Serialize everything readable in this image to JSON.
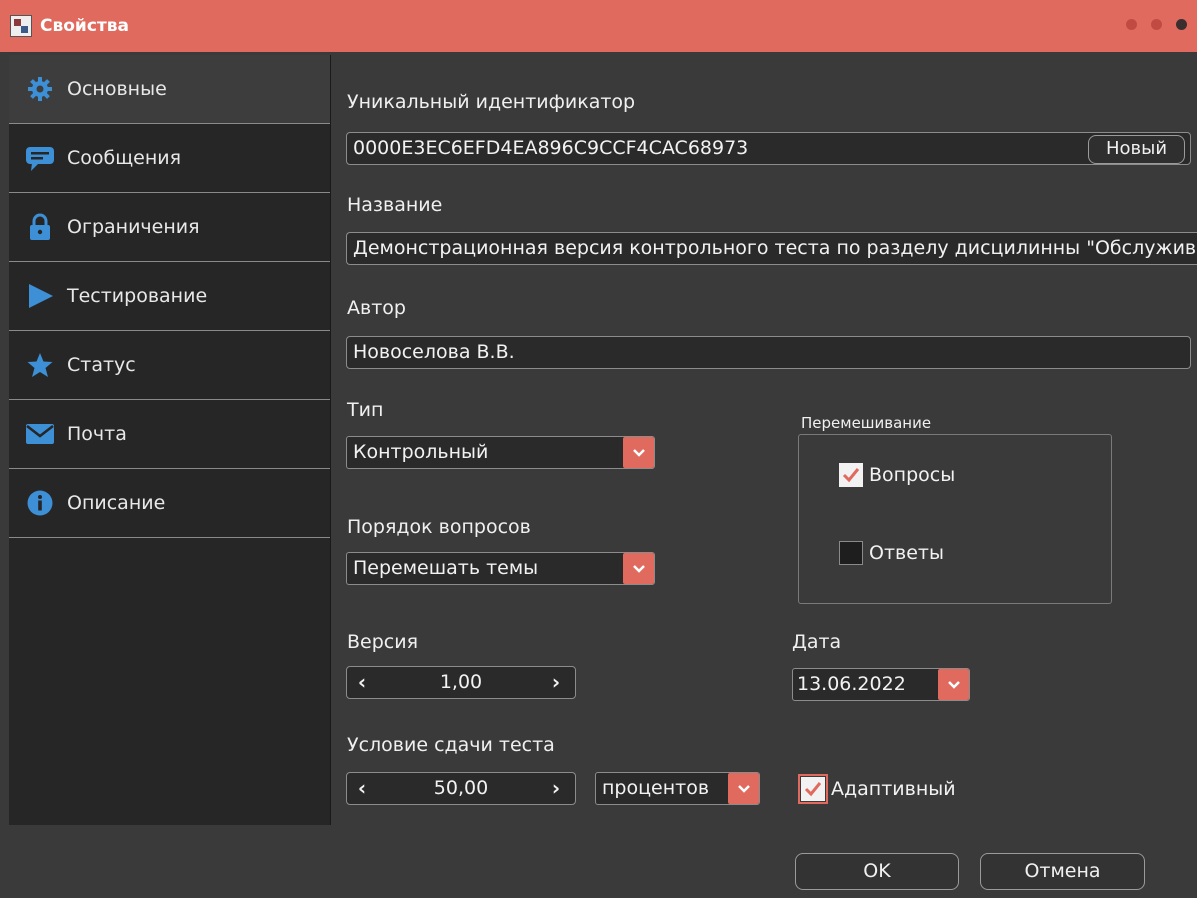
{
  "window": {
    "title": "Свойства"
  },
  "sidebar": {
    "items": [
      {
        "label": "Основные",
        "icon": "gear-icon"
      },
      {
        "label": "Сообщения",
        "icon": "message-icon"
      },
      {
        "label": "Ограничения",
        "icon": "lock-icon"
      },
      {
        "label": "Тестирование",
        "icon": "play-icon"
      },
      {
        "label": "Статус",
        "icon": "star-icon"
      },
      {
        "label": "Почта",
        "icon": "mail-icon"
      },
      {
        "label": "Описание",
        "icon": "info-icon"
      }
    ],
    "active_index": 0
  },
  "form": {
    "uid_label": "Уникальный идентификатор",
    "uid_value": "0000E3EC6EFD4EA896C9CCF4CAC68973",
    "new_button": "Новый",
    "name_label": "Название",
    "name_value": "Демонстрационная версия контрольного теста по разделу дисцилинны \"Обслужива",
    "author_label": "Автор",
    "author_value": "Новоселова В.В.",
    "type_label": "Тип",
    "type_value": "Контрольный",
    "order_label": "Порядок вопросов",
    "order_value": "Перемешать темы",
    "shuffle_group": "Перемешивание",
    "shuffle_questions": {
      "label": "Вопросы",
      "checked": true
    },
    "shuffle_answers": {
      "label": "Ответы",
      "checked": false
    },
    "version_label": "Версия",
    "version_value": "1,00",
    "date_label": "Дата",
    "date_value": "13.06.2022",
    "pass_label": "Условие сдачи теста",
    "pass_value": "50,00",
    "pass_unit": "процентов",
    "adaptive": {
      "label": "Адаптивный",
      "checked": true
    }
  },
  "buttons": {
    "ok": "OK",
    "cancel": "Отмена"
  },
  "colors": {
    "accent": "#e06a5e",
    "background": "#3a3a3a",
    "sidebar": "#262626",
    "icon_blue": "#3d8fd6"
  }
}
